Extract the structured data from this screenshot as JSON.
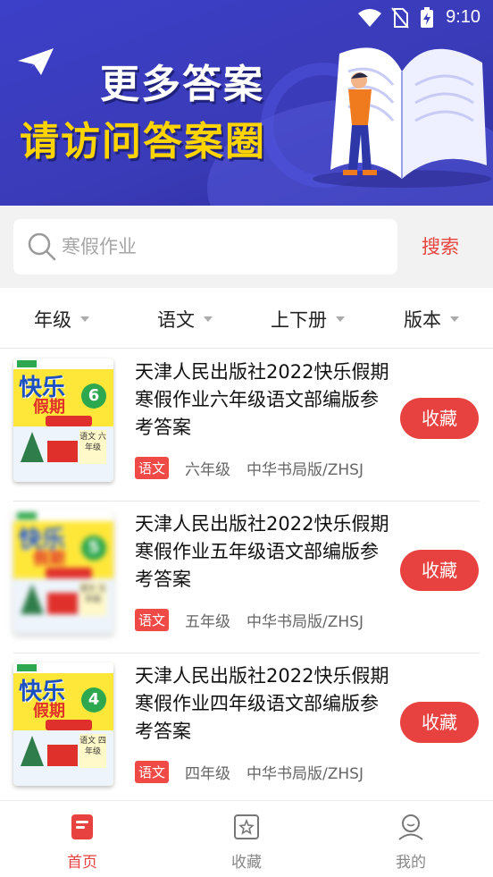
{
  "status_bar": {
    "time": "9:10"
  },
  "banner": {
    "line1": "更多答案",
    "line2": "请访问答案圈"
  },
  "search": {
    "placeholder": "寒假作业",
    "button_label": "搜索"
  },
  "filters": [
    {
      "label": "年级"
    },
    {
      "label": "语文"
    },
    {
      "label": "上下册"
    },
    {
      "label": "版本"
    }
  ],
  "items": [
    {
      "title": "天津人民出版社2022快乐假期寒假作业六年级语文部编版参考答案",
      "subject": "语文",
      "grade": "六年级",
      "publisher": "中华书局版/ZHSJ",
      "fav_label": "收藏",
      "cover": {
        "title": "快乐",
        "subtitle": "假期",
        "grade_num": "6",
        "label": "语文 六年级"
      }
    },
    {
      "title": "天津人民出版社2022快乐假期寒假作业五年级语文部编版参考答案",
      "subject": "语文",
      "grade": "五年级",
      "publisher": "中华书局版/ZHSJ",
      "fav_label": "收藏",
      "cover": {
        "title": "快乐",
        "subtitle": "假期",
        "grade_num": "5",
        "label": "语文 五年级"
      }
    },
    {
      "title": "天津人民出版社2022快乐假期寒假作业四年级语文部编版参考答案",
      "subject": "语文",
      "grade": "四年级",
      "publisher": "中华书局版/ZHSJ",
      "fav_label": "收藏",
      "cover": {
        "title": "快乐",
        "subtitle": "假期",
        "grade_num": "4",
        "label": "语文 四年级"
      }
    }
  ],
  "bottom_nav": [
    {
      "label": "首页",
      "icon": "home-book-icon",
      "active": true
    },
    {
      "label": "收藏",
      "icon": "star-icon",
      "active": false
    },
    {
      "label": "我的",
      "icon": "user-icon",
      "active": false
    }
  ],
  "colors": {
    "accent": "#e84240",
    "banner": "#3c3fc8",
    "headline_yellow": "#ffd400"
  }
}
